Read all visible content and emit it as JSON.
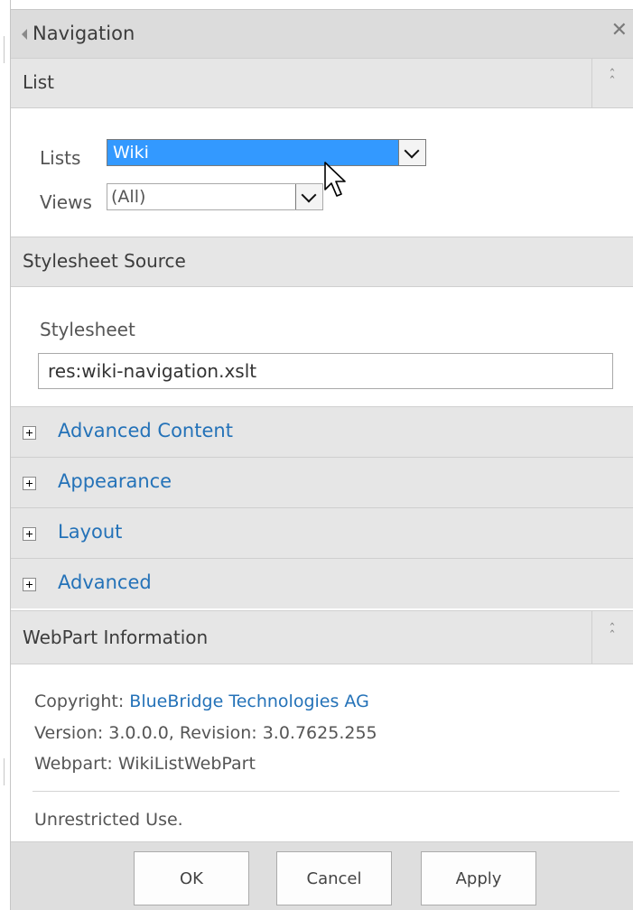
{
  "panel": {
    "title": "Navigation"
  },
  "list_section": {
    "title": "List",
    "lists_label": "Lists",
    "lists_value": "Wiki",
    "views_label": "Views",
    "views_value": "(All)"
  },
  "stylesheet_section": {
    "title": "Stylesheet Source",
    "field_label": "Stylesheet",
    "field_value": "res:wiki-navigation.xslt"
  },
  "accordions": [
    {
      "label": "Advanced Content"
    },
    {
      "label": "Appearance"
    },
    {
      "label": "Layout"
    },
    {
      "label": "Advanced"
    }
  ],
  "webpart_info": {
    "title": "WebPart Information",
    "copyright_prefix": "Copyright:",
    "copyright_link": "BlueBridge Technologies AG",
    "version": "Version: 3.0.0.0, Revision: 3.0.7625.255",
    "webpart": "Webpart: WikiListWebPart",
    "license": "Unrestricted Use."
  },
  "buttons": {
    "ok": "OK",
    "cancel": "Cancel",
    "apply": "Apply"
  },
  "icons": {
    "back": "triangle-left-icon",
    "close": "close-icon",
    "collapse": "double-chevron-up-icon",
    "expand": "plus-box-icon",
    "dropdown": "chevron-down-icon",
    "cursor": "mouse-pointer-icon"
  },
  "colors": {
    "link": "#2472b8",
    "selection": "#3399ff",
    "header_bg": "#e6e6e6"
  }
}
